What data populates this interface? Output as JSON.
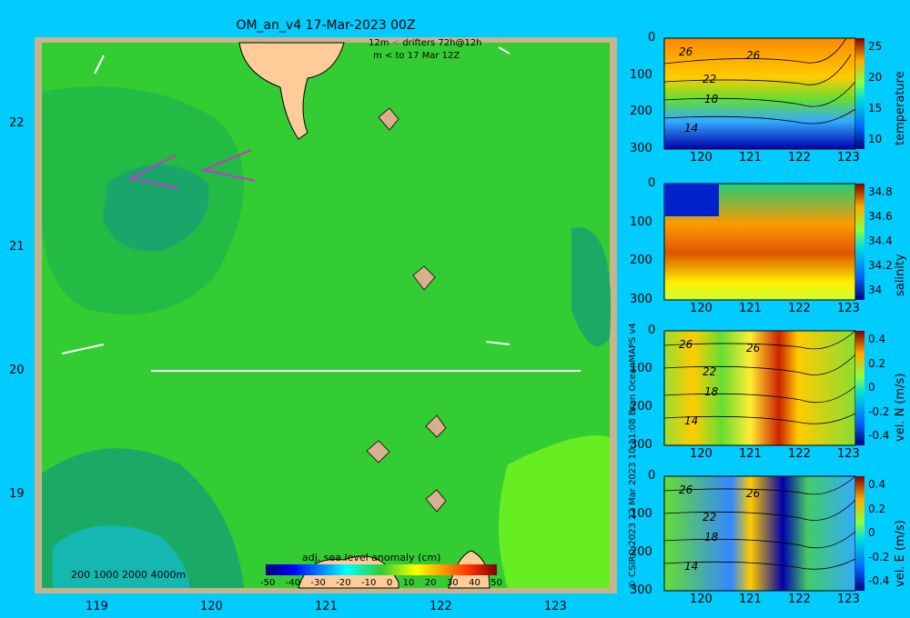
{
  "map": {
    "title": "OM_an_v4  17-Mar-2023 00Z",
    "legend_line1": "12m",
    "legend_line1b": "drifters 72h@12h",
    "legend_line2": "m",
    "legend_line2b": "to 17 Mar 12Z",
    "depth_legend": "200  1000  2000  4000m",
    "colorbar_title": "adj. sea level anomaly (cm)",
    "colorbar_ticks": [
      "-50",
      "-40",
      "-30",
      "-20",
      "-10",
      "0",
      "10",
      "20",
      "30",
      "40",
      "50"
    ],
    "x_ticks": [
      "119",
      "120",
      "121",
      "122",
      "123"
    ],
    "y_ticks": [
      "22",
      "21",
      "20",
      "19"
    ],
    "copyright": "© CSIRO 2023   22 Mar 2023 10:11:08 Bran OceanMAPS v4"
  },
  "panels": [
    {
      "id": "temperature",
      "ylabel": "temperature",
      "cbar_ticks": [
        "25",
        "20",
        "15",
        "10"
      ],
      "contour_labels": [
        "26",
        "26",
        "22",
        "18",
        "14"
      ]
    },
    {
      "id": "salinity",
      "ylabel": "salinity",
      "cbar_ticks": [
        "34.8",
        "34.6",
        "34.4",
        "34.2",
        "34"
      ],
      "contour_labels": []
    },
    {
      "id": "velN",
      "ylabel": "vel. N (m/s)",
      "cbar_ticks": [
        "0.4",
        "0.2",
        "0",
        "-0.2",
        "-0.4"
      ],
      "contour_labels": [
        "26",
        "26",
        "22",
        "18",
        "14"
      ]
    },
    {
      "id": "velE",
      "ylabel": "vel. E (m/s)",
      "cbar_ticks": [
        "0.4",
        "0.2",
        "0",
        "-0.2",
        "-0.4"
      ],
      "contour_labels": [
        "26",
        "26",
        "22",
        "18",
        "14"
      ]
    }
  ],
  "panel_x_ticks": [
    "120",
    "121",
    "122",
    "123"
  ],
  "panel_y_ticks": [
    "0",
    "100",
    "200",
    "300"
  ],
  "chart_data": [
    {
      "type": "heatmap",
      "title": "OM_an_v4  17-Mar-2023 00Z",
      "xlabel": "",
      "ylabel": "",
      "xlim": [
        118.5,
        123.5
      ],
      "ylim": [
        18.3,
        22.7
      ],
      "colorbar": {
        "label": "adj. sea level anomaly (cm)",
        "range": [
          -50,
          50
        ]
      },
      "transect": {
        "lat": 20,
        "lon_start": 119.5,
        "lon_end": 123.2
      }
    },
    {
      "type": "heatmap",
      "ylabel": "temperature",
      "xlim": [
        119.5,
        123.2
      ],
      "ylim": [
        300,
        0
      ],
      "colorbar_range": [
        10,
        28
      ]
    },
    {
      "type": "heatmap",
      "ylabel": "salinity",
      "xlim": [
        119.5,
        123.2
      ],
      "ylim": [
        300,
        0
      ],
      "colorbar_range": [
        33.9,
        34.9
      ]
    },
    {
      "type": "heatmap",
      "ylabel": "vel. N (m/s)",
      "xlim": [
        119.5,
        123.2
      ],
      "ylim": [
        300,
        0
      ],
      "colorbar_range": [
        -0.4,
        0.5
      ]
    },
    {
      "type": "heatmap",
      "ylabel": "vel. E (m/s)",
      "xlim": [
        119.5,
        123.2
      ],
      "ylim": [
        300,
        0
      ],
      "colorbar_range": [
        -0.4,
        0.5
      ]
    }
  ]
}
